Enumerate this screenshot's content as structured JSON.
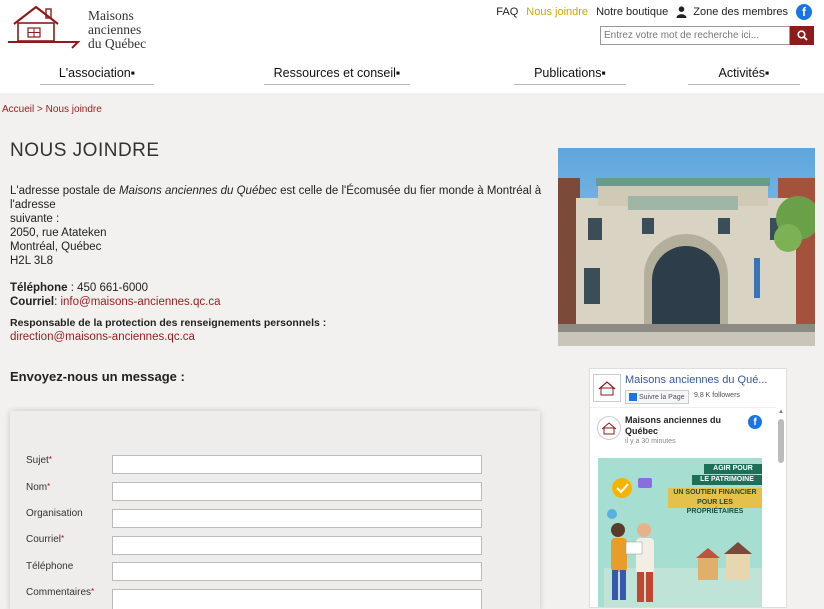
{
  "header": {
    "logo_text_1": "Maisons",
    "logo_text_2": "anciennes",
    "logo_text_3": "du Québec",
    "faq": "FAQ",
    "contact": "Nous joindre",
    "shop": "Notre boutique",
    "members": "Zone des membres",
    "search_placeholder": "Entrez votre mot de recherche ici...",
    "accent_color": "#8c1b1b"
  },
  "nav": {
    "items": [
      {
        "label": "L'association"
      },
      {
        "label": "Ressources et conseil"
      },
      {
        "label": "Publications"
      },
      {
        "label": "Activités"
      }
    ]
  },
  "breadcrumb": {
    "home": "Accueil",
    "separator": " > ",
    "current": "Nous joindre"
  },
  "page": {
    "title": "NOUS JOINDRE",
    "intro_1": "L'adresse postale de ",
    "intro_org": "Maisons anciennes du Québec",
    "intro_2": " est celle de l'Écomusée du fier monde à Montréal à l'adresse",
    "intro_3": "suivante :",
    "address_1": "2050, rue Atateken",
    "address_2": "Montréal, Québec",
    "address_3": "H2L 3L8",
    "phone_label": "Téléphone",
    "phone": " : 450 661-6000",
    "email_label": "Courriel",
    "email_sep": ": ",
    "email": "info@maisons-anciennes.qc.ca",
    "privacy_label": "Responsable de la protection des renseignements personnels :",
    "privacy_email": "direction@maisons-anciennes.qc.ca"
  },
  "form": {
    "heading": "Envoyez-nous un message :",
    "fields": [
      {
        "label": "Sujet",
        "required": "*"
      },
      {
        "label": "Nom",
        "required": "*"
      },
      {
        "label": "Organisation",
        "required": ""
      },
      {
        "label": "Courriel",
        "required": "*"
      },
      {
        "label": "Téléphone",
        "required": ""
      },
      {
        "label": "Commentaires",
        "required": "*"
      }
    ]
  },
  "facebook": {
    "page_name": "Maisons anciennes du Qué...",
    "follow": "Suivre la Page",
    "followers": "9,8 K followers",
    "post_author": "Maisons anciennes du Québec",
    "post_time": "il y a 30 minutes",
    "banner_1": "AGIR POUR",
    "banner_2": "LE PATRIMOINE",
    "banner_3": "UN SOUTIEN FINANCIER",
    "banner_4": "POUR LES PROPRIÉTAIRES"
  },
  "icons": {
    "user": "user-icon",
    "facebook": "facebook-icon",
    "search": "search-icon"
  }
}
